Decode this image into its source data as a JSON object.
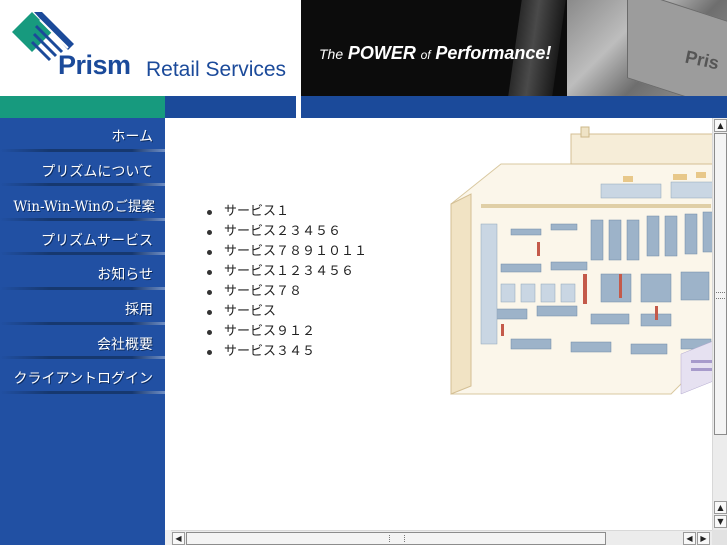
{
  "header": {
    "logo": {
      "brand": "Prism",
      "suffix": "Retail Services",
      "mark_colors": {
        "teal": "#179a7e",
        "navy": "#1b4a9a"
      }
    },
    "tagline": {
      "the": "The",
      "power": "POWER",
      "of": "of",
      "performance": "Performance!"
    },
    "banner_photo_text": "Pris"
  },
  "colors": {
    "accent_green": "#179a7e",
    "brand_blue": "#1b4a9a",
    "sidebar_blue": "#2150a3",
    "banner_black": "#0c0c0c"
  },
  "sidebar": {
    "items": [
      {
        "label": "ホーム"
      },
      {
        "label": "プリズムについて"
      },
      {
        "label": "Win-Win-Winのご提案"
      },
      {
        "label": "プリズムサービス"
      },
      {
        "label": "お知らせ"
      },
      {
        "label": "採用"
      },
      {
        "label": "会社概要"
      },
      {
        "label": "クライアントログイン"
      }
    ]
  },
  "main": {
    "services": [
      "サービス１",
      "サービス２３４５６",
      "サービス７８９１０１１",
      "サービス１２３４５６",
      "サービス７８",
      "サービス",
      "サービス９１２",
      "サービス３４５"
    ]
  }
}
